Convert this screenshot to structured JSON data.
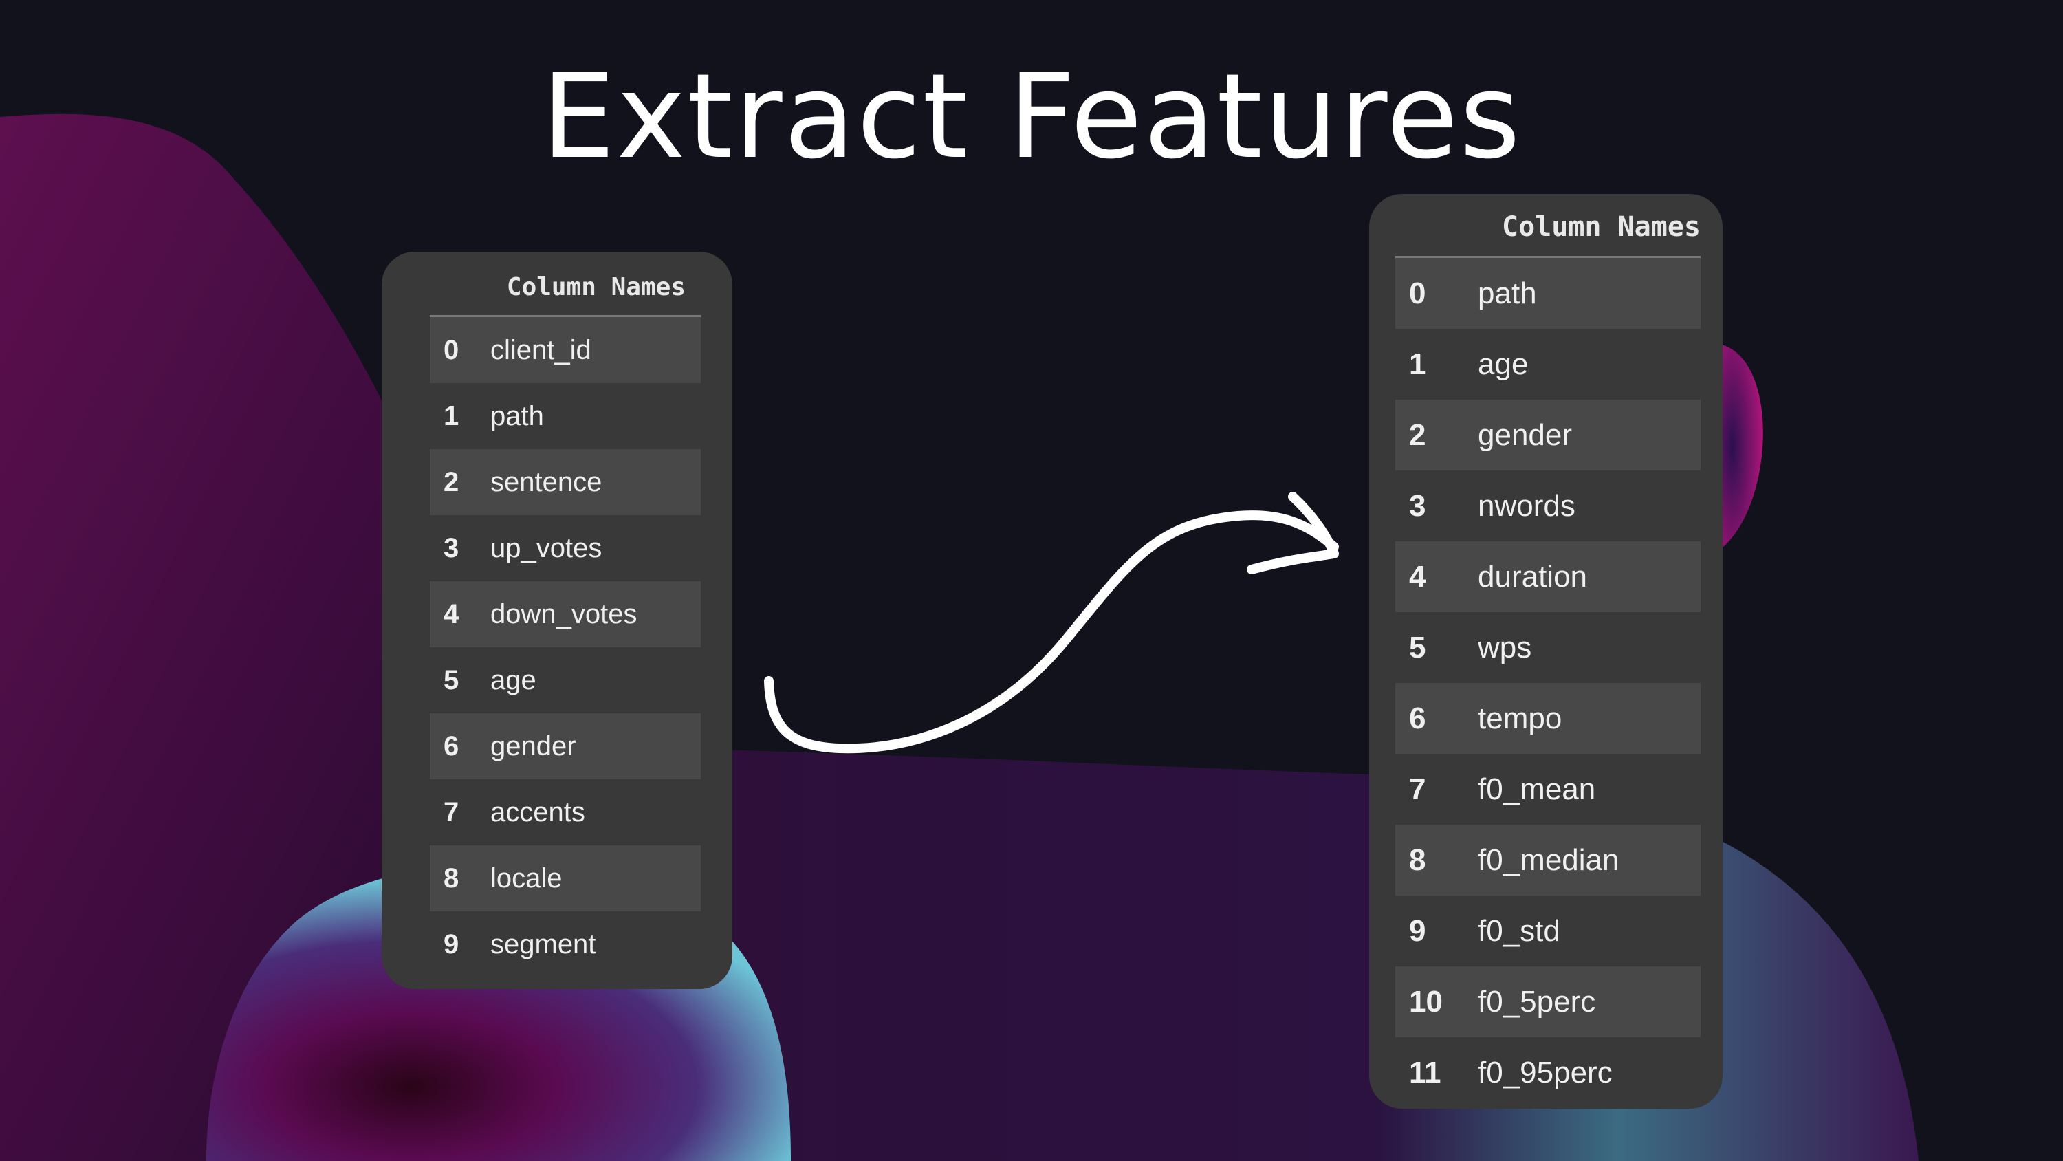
{
  "title": "Extract Features",
  "colors": {
    "background": "#12121c",
    "panel": "#393939",
    "row_alt": "#484848",
    "blob_magenta": "#5a0f4c",
    "blob_teal": "#5fb6c9",
    "arrow": "#ffffff"
  },
  "left_table": {
    "header": "Column Names",
    "rows": [
      {
        "index": "0",
        "name": "client_id"
      },
      {
        "index": "1",
        "name": "path"
      },
      {
        "index": "2",
        "name": "sentence"
      },
      {
        "index": "3",
        "name": "up_votes"
      },
      {
        "index": "4",
        "name": "down_votes"
      },
      {
        "index": "5",
        "name": "age"
      },
      {
        "index": "6",
        "name": "gender"
      },
      {
        "index": "7",
        "name": "accents"
      },
      {
        "index": "8",
        "name": "locale"
      },
      {
        "index": "9",
        "name": "segment"
      }
    ]
  },
  "right_table": {
    "header": "Column Names",
    "rows": [
      {
        "index": "0",
        "name": "path"
      },
      {
        "index": "1",
        "name": "age"
      },
      {
        "index": "2",
        "name": "gender"
      },
      {
        "index": "3",
        "name": "nwords"
      },
      {
        "index": "4",
        "name": "duration"
      },
      {
        "index": "5",
        "name": "wps"
      },
      {
        "index": "6",
        "name": "tempo"
      },
      {
        "index": "7",
        "name": "f0_mean"
      },
      {
        "index": "8",
        "name": "f0_median"
      },
      {
        "index": "9",
        "name": "f0_std"
      },
      {
        "index": "10",
        "name": "f0_5perc"
      },
      {
        "index": "11",
        "name": "f0_95perc"
      }
    ]
  },
  "icons": {
    "arrow": "curved-arrow-icon"
  }
}
